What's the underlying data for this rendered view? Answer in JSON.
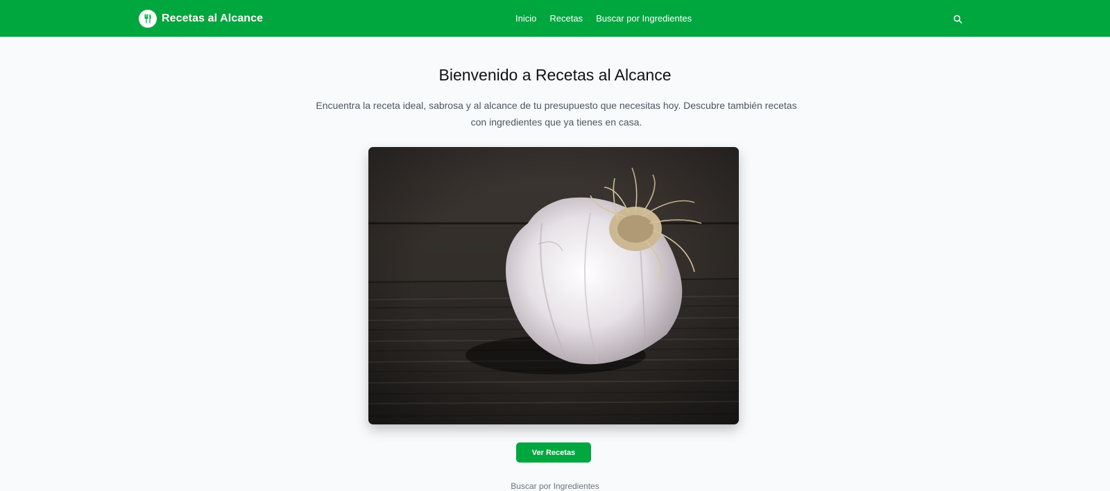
{
  "brand": {
    "name": "Recetas al Alcance",
    "logo_icon": "utensils-icon"
  },
  "nav": {
    "links": [
      "Inicio",
      "Recetas",
      "Buscar por Ingredientes"
    ],
    "search_icon": "search-icon"
  },
  "hero": {
    "title": "Bienvenido a Recetas al Alcance",
    "subtitle": "Encuentra la receta ideal, sabrosa y al alcance de tu presupuesto que necesitas hoy. Descubre también recetas con ingredientes que ya tienes en casa.",
    "image_subject": "garlic bulb on dark wooden surface",
    "cta_label": "Ver Recetas",
    "secondary_link": "Buscar por Ingredientes"
  },
  "colors": {
    "primary": "#00a63e",
    "background": "#f8fafc",
    "text": "#111111",
    "muted_text": "#4b5563"
  }
}
